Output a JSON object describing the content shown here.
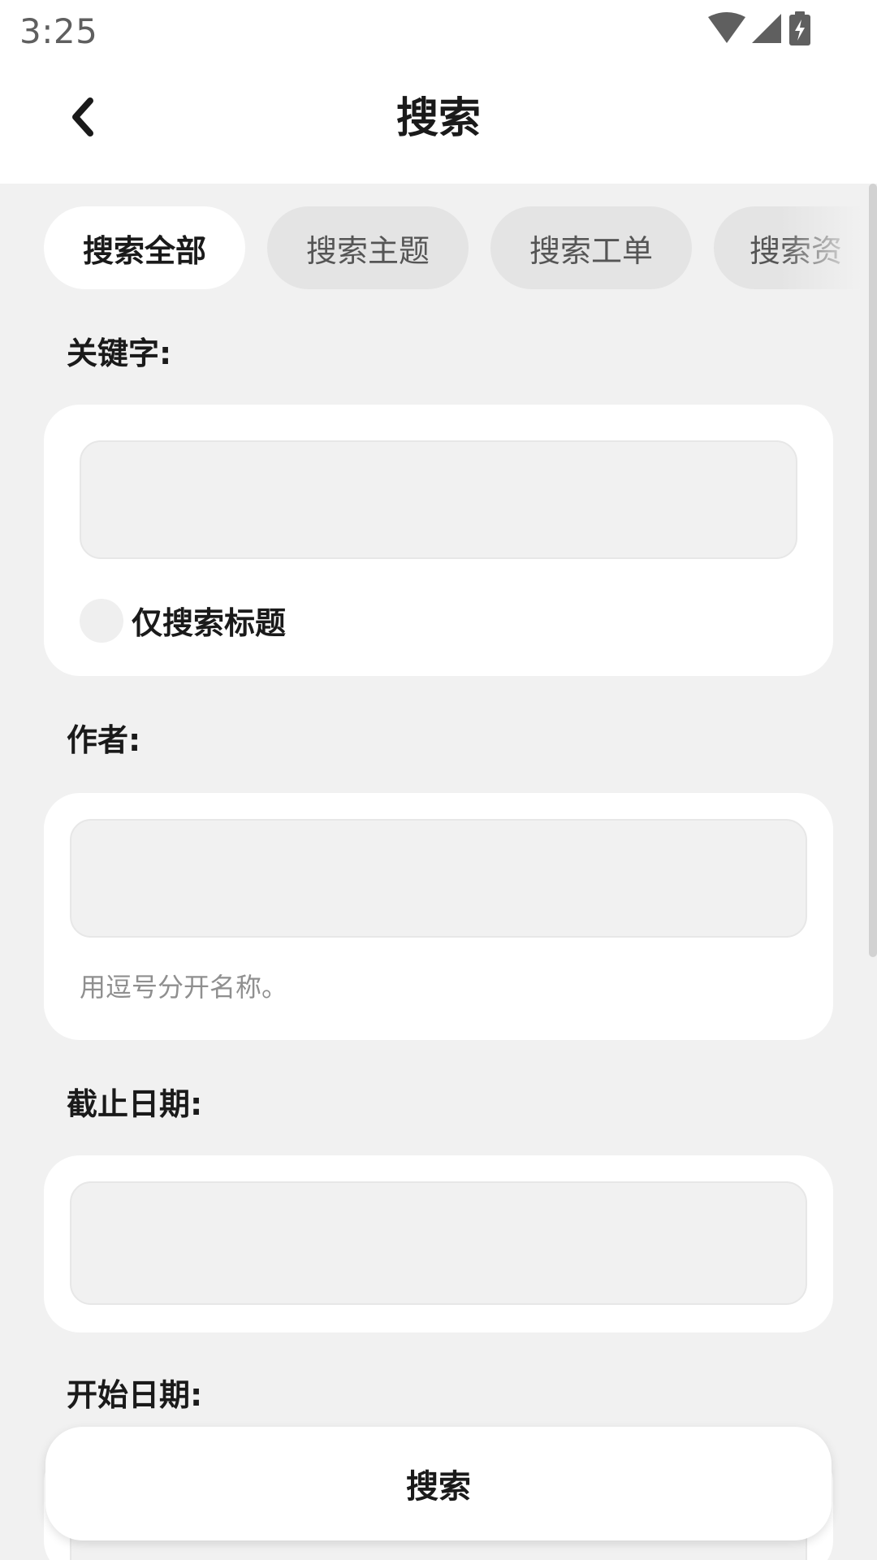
{
  "status_bar": {
    "time": "3:25",
    "icons": [
      "wifi-icon",
      "signal-icon",
      "battery-charging-icon"
    ]
  },
  "header": {
    "back_icon": "chevron-left-icon",
    "title": "搜索"
  },
  "tabs": [
    {
      "label": "搜索全部",
      "active": true
    },
    {
      "label": "搜索主题",
      "active": false
    },
    {
      "label": "搜索工单",
      "active": false
    },
    {
      "label": "搜索资",
      "active": false
    }
  ],
  "keyword": {
    "label": "关键字:",
    "value": "",
    "title_only_label": "仅搜索标题"
  },
  "author": {
    "label": "作者:",
    "value": "",
    "helper": "用逗号分开名称。"
  },
  "end_date": {
    "label": "截止日期:",
    "value": ""
  },
  "start_date": {
    "label": "开始日期:"
  },
  "search_button": {
    "label": "搜索"
  },
  "colors": {
    "background": "#f1f1f1",
    "card": "#ffffff",
    "tab_inactive": "#e4e4e4",
    "text": "#1a1a1a",
    "helper_text": "#8f8f8f"
  }
}
